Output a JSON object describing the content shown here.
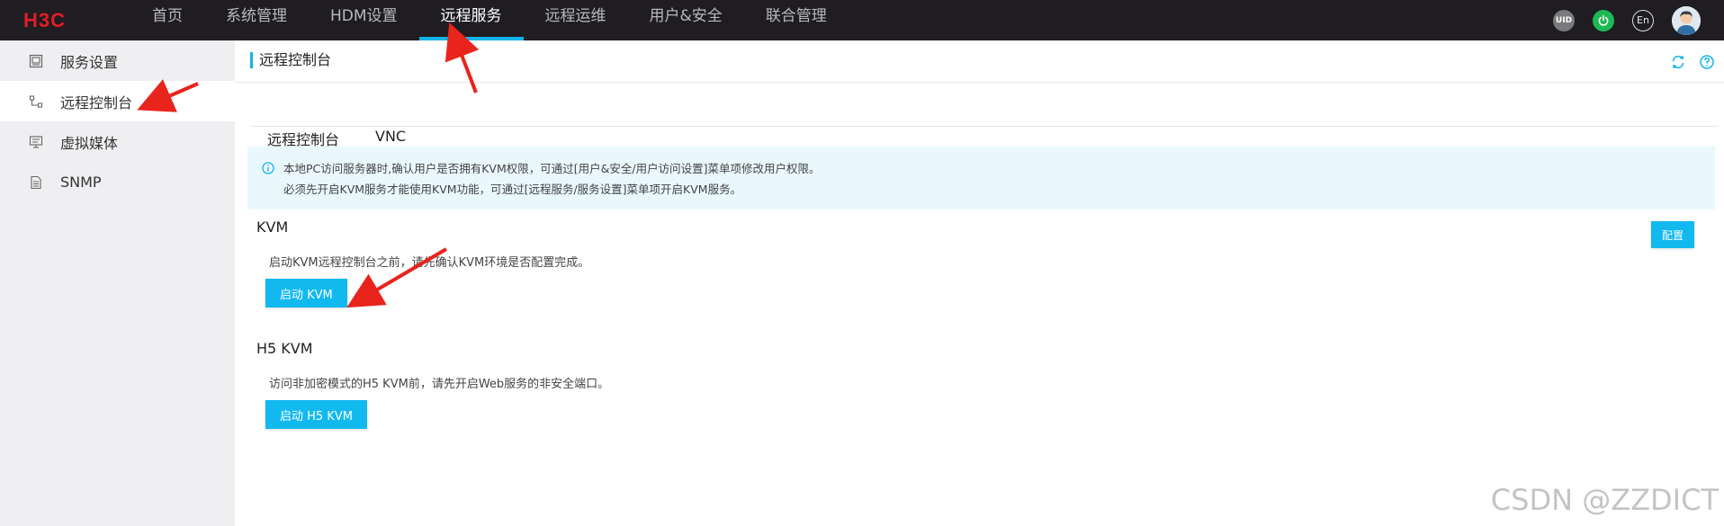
{
  "brand": {
    "logo_text": "H3C",
    "logo_color": "#e21d26"
  },
  "nav": {
    "items": [
      {
        "label": "首页",
        "active": false
      },
      {
        "label": "系统管理",
        "active": false
      },
      {
        "label": "HDM设置",
        "active": false
      },
      {
        "label": "远程服务",
        "active": true
      },
      {
        "label": "远程运维",
        "active": false
      },
      {
        "label": "用户&安全",
        "active": false
      },
      {
        "label": "联合管理",
        "active": false
      }
    ]
  },
  "top_icons": {
    "uid": "UID",
    "lang": "En",
    "power": "power-icon",
    "avatar": "user-avatar"
  },
  "sidebar": {
    "items": [
      {
        "label": "服务设置",
        "icon": "service-settings-icon",
        "active": false
      },
      {
        "label": "远程控制台",
        "active": true,
        "icon": "remote-console-icon"
      },
      {
        "label": "虚拟媒体",
        "active": false,
        "icon": "virtual-media-icon"
      },
      {
        "label": "SNMP",
        "active": false,
        "icon": "snmp-icon"
      }
    ]
  },
  "page": {
    "title": "远程控制台",
    "tabs": [
      {
        "label": "远程控制台",
        "active": true
      },
      {
        "label": "VNC",
        "active": false
      }
    ],
    "notice": {
      "line1": "本地PC访问服务器时,确认用户是否拥有KVM权限，可通过[用户&安全/用户访问设置]菜单项修改用户权限。",
      "line2": "必须先开启KVM服务才能使用KVM功能，可通过[远程服务/服务设置]菜单项开启KVM服务。"
    },
    "kvm": {
      "title": "KVM",
      "config_button": "配置",
      "desc": "启动KVM远程控制台之前，请先确认KVM环境是否配置完成。",
      "start_button": "启动 KVM"
    },
    "h5kvm": {
      "title": "H5 KVM",
      "desc": "访问非加密模式的H5 KVM前，请先开启Web服务的非安全端口。",
      "start_button": "启动 H5 KVM"
    }
  },
  "watermark": "CSDN @ZZDICT",
  "colors": {
    "accent": "#12b4e8",
    "button": "#12b9ef",
    "topbar": "#1f1d21",
    "annotation_arrow": "#e8241c"
  }
}
